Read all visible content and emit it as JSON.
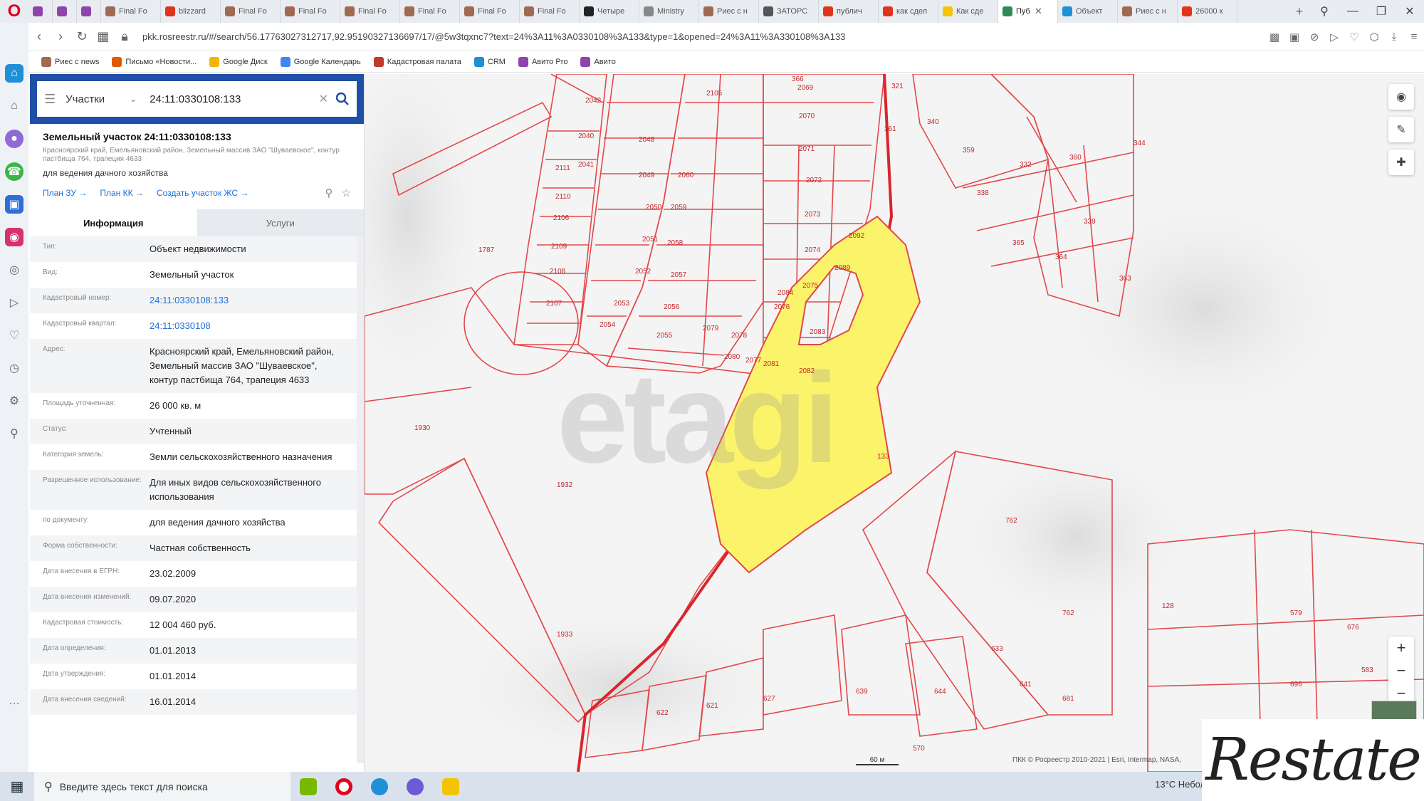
{
  "browser": {
    "tabs": [
      {
        "label": "",
        "color": "#8e44ad"
      },
      {
        "label": "",
        "color": "#8e44ad"
      },
      {
        "label": "",
        "color": "#8e44ad"
      },
      {
        "label": "Final Fo",
        "color": "#a06a50"
      },
      {
        "label": "blizzard",
        "color": "#e0341b"
      },
      {
        "label": "Final Fo",
        "color": "#a06a50"
      },
      {
        "label": "Final Fo",
        "color": "#a06a50"
      },
      {
        "label": "Final Fo",
        "color": "#a06a50"
      },
      {
        "label": "Final Fo",
        "color": "#a06a50"
      },
      {
        "label": "Final Fo",
        "color": "#a06a50"
      },
      {
        "label": "Final Fo",
        "color": "#a06a50"
      },
      {
        "label": "Четыре",
        "color": "#222222"
      },
      {
        "label": "Ministry",
        "color": "#888888"
      },
      {
        "label": "Риес с н",
        "color": "#a06a50"
      },
      {
        "label": "ЗАТОРС",
        "color": "#555555"
      },
      {
        "label": "публич",
        "color": "#e0341b"
      },
      {
        "label": "как сдел",
        "color": "#e0341b"
      },
      {
        "label": "Как сде",
        "color": "#f5c400"
      },
      {
        "label": "Пуб",
        "color": "#2e8b57",
        "active": true
      },
      {
        "label": "Объект",
        "color": "#1f8fd6"
      },
      {
        "label": "Риес с н",
        "color": "#a06a50"
      },
      {
        "label": "26000 к",
        "color": "#e0341b"
      }
    ],
    "url": "pkk.rosreestr.ru/#/search/56.17763027312717,92.95190327136697/17/@5w3tqxnc7?text=24%3A11%3A0330108%3A133&type=1&opened=24%3A11%3A330108%3A133",
    "bookmarks": [
      {
        "label": "Риес с news",
        "color": "#a06a50"
      },
      {
        "label": "Письмо «Новости...",
        "color": "#e05a00"
      },
      {
        "label": "Google Диск",
        "color": "#f4b400"
      },
      {
        "label": "Google Календарь",
        "color": "#4285f4"
      },
      {
        "label": "Кадастровая палата",
        "color": "#c0392b"
      },
      {
        "label": "CRM",
        "color": "#1f8fd6"
      },
      {
        "label": "Авито Pro",
        "color": "#8e44ad"
      },
      {
        "label": "Авито",
        "color": "#8e44ad"
      }
    ]
  },
  "search": {
    "type_label": "Участки",
    "value": "24:11:0330108:133"
  },
  "object": {
    "title": "Земельный участок 24:11:0330108:133",
    "address_short": "Красноярский край, Емельяновский район, Земельный массив ЗАО \"Шуваевское\", контур пастбища 764, трапеция 4633",
    "purpose": "для ведения дачного хозяйства",
    "links": [
      "План ЗУ →",
      "План КК →",
      "Создать участок ЖС →"
    ]
  },
  "tabs": {
    "info": "Информация",
    "services": "Услуги"
  },
  "properties": [
    {
      "label": "Тип:",
      "value": "Объект недвижимости"
    },
    {
      "label": "Вид:",
      "value": "Земельный участок"
    },
    {
      "label": "Кадастровый номер:",
      "value": "24:11:0330108:133",
      "link": true
    },
    {
      "label": "Кадастровый квартал:",
      "value": "24:11:0330108",
      "link": true
    },
    {
      "label": "Адрес:",
      "value": "Красноярский край, Емельяновский район, Земельный массив ЗАО \"Шуваевское\", контур пастбища 764, трапеция 4633"
    },
    {
      "label": "Площадь уточненная:",
      "value": "26 000 кв. м"
    },
    {
      "label": "Статус:",
      "value": "Учтенный"
    },
    {
      "label": "Категория земель:",
      "value": "Земли сельскохозяйственного назначения"
    },
    {
      "label": "Разрешенное использование:",
      "value": "Для иных видов сельскохозяйственного использования"
    },
    {
      "label": "по документу:",
      "value": "для ведения дачного хозяйства"
    },
    {
      "label": "Форма собственности:",
      "value": "Частная собственность"
    },
    {
      "label": "Дата внесения в ЕГРН:",
      "value": "23.02.2009"
    },
    {
      "label": "Дата внесения изменений:",
      "value": "09.07.2020"
    },
    {
      "label": "Кадастровая стоимость:",
      "value": "12 004 460 руб."
    },
    {
      "label": "Дата определения:",
      "value": "01.01.2013"
    },
    {
      "label": "Дата утверждения:",
      "value": "01.01.2014"
    },
    {
      "label": "Дата внесения сведений:",
      "value": "16.01.2014"
    }
  ],
  "map": {
    "watermark": "etagi",
    "scale_label": "60 м",
    "attribution": "ПКК © Росреестр 2010-2021 | Esri, Intermap, NASA,",
    "parcel_labels": [
      {
        "text": "2069"
      },
      {
        "text": "2070"
      },
      {
        "text": "2071"
      },
      {
        "text": "2072"
      },
      {
        "text": "2073"
      },
      {
        "text": "2074"
      },
      {
        "text": "2075"
      },
      {
        "text": "2076"
      },
      {
        "text": "2077"
      },
      {
        "text": "2078"
      },
      {
        "text": "2079"
      },
      {
        "text": "2080"
      },
      {
        "text": "2081"
      },
      {
        "text": "2082"
      },
      {
        "text": "2083"
      },
      {
        "text": "2084"
      },
      {
        "text": "2089"
      },
      {
        "text": "2092"
      },
      {
        "text": "2105"
      },
      {
        "text": "2040"
      },
      {
        "text": "2041"
      },
      {
        "text": "2042"
      },
      {
        "text": "2048"
      },
      {
        "text": "2049"
      },
      {
        "text": "2050"
      },
      {
        "text": "2051"
      },
      {
        "text": "2052"
      },
      {
        "text": "2053"
      },
      {
        "text": "2054"
      },
      {
        "text": "2055"
      },
      {
        "text": "2056"
      },
      {
        "text": "2057"
      },
      {
        "text": "2058"
      },
      {
        "text": "2059"
      },
      {
        "text": "2060"
      },
      {
        "text": "2106"
      },
      {
        "text": "2107"
      },
      {
        "text": "2108"
      },
      {
        "text": "2109"
      },
      {
        "text": "2110"
      },
      {
        "text": "2111"
      },
      {
        "text": "1787"
      },
      {
        "text": "1930"
      },
      {
        "text": "1932"
      },
      {
        "text": "1933"
      },
      {
        "text": "133"
      },
      {
        "text": "762"
      },
      {
        "text": "762"
      },
      {
        "text": "128"
      },
      {
        "text": "579"
      },
      {
        "text": "676"
      },
      {
        "text": "696"
      },
      {
        "text": "583"
      },
      {
        "text": "633"
      },
      {
        "text": "641"
      },
      {
        "text": "681"
      },
      {
        "text": "627"
      },
      {
        "text": "621"
      },
      {
        "text": "622"
      },
      {
        "text": "639"
      },
      {
        "text": "644"
      },
      {
        "text": "570"
      },
      {
        "text": "366"
      },
      {
        "text": "321"
      },
      {
        "text": "340"
      },
      {
        "text": "361"
      },
      {
        "text": "359"
      },
      {
        "text": "332"
      },
      {
        "text": "360"
      },
      {
        "text": "338"
      },
      {
        "text": "365"
      },
      {
        "text": "364"
      },
      {
        "text": "339"
      },
      {
        "text": "363"
      },
      {
        "text": "344"
      }
    ]
  },
  "taskbar": {
    "search_placeholder": "Введите здесь текст для поиска",
    "tray": "13°C  Неболь"
  },
  "logo": "Restate",
  "colors": {
    "panel_header": "#1f4fa6",
    "parcel_stroke": "#e3484b",
    "selected_fill": "#fbf36a"
  }
}
